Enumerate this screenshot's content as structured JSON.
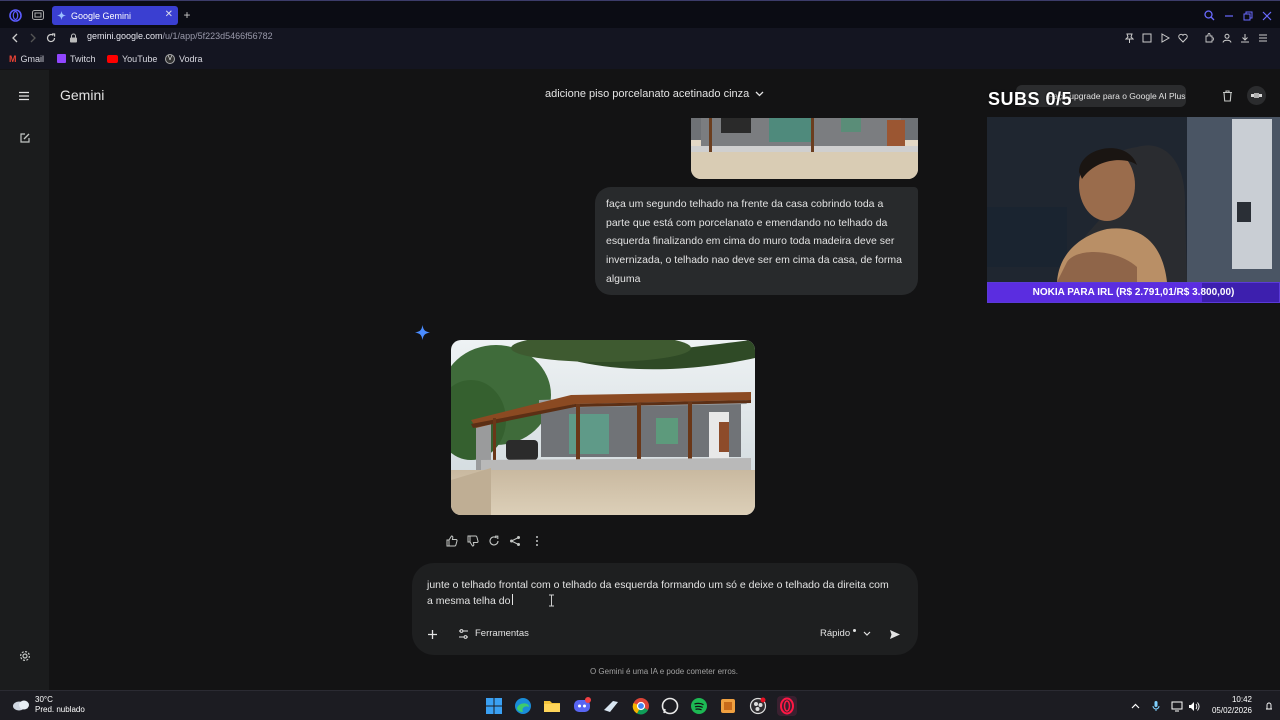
{
  "browser": {
    "tab_title": "Google Gemini",
    "url_domain": "gemini.google.com",
    "url_path": "/u/1/app/5f223d5466f56782",
    "bookmarks": [
      "Gmail",
      "Twitch",
      "YouTube",
      "Vodra"
    ]
  },
  "app": {
    "name": "Gemini",
    "conversation_title": "adicione piso porcelanato acetinado cinza",
    "upgrade_text": "Faça upgrade para o Google AI Plus"
  },
  "chat": {
    "user_message": "faça um segundo telhado na frente da casa cobrindo toda a parte que está com porcelanato e emendando no telhado da esquerda finalizando em cima do muro toda madeira deve ser invernizada, o telhado nao deve ser em cima da casa, de forma alguma",
    "input_text": "junte o telhado frontal com o telhado da esquerda formando um só e deixe o telhado da direita com a mesma telha do",
    "tools_label": "Ferramentas",
    "mode_label": "Rápido",
    "disclaimer": "O Gemini é uma IA e pode cometer erros."
  },
  "overlay": {
    "subs_label": "SUBS",
    "subs_count": "0/5",
    "goal_text": "NOKIA PARA IRL (R$ 2.791,01/R$ 3.800,00)",
    "goal_progress": 0.7345
  },
  "taskbar": {
    "temperature": "30°C",
    "weather_desc": "Pred. nublado",
    "time": "10:42",
    "date": "05/02/2026"
  },
  "colors": {
    "background": "#131314",
    "accent_tab": "#3a3fd1",
    "gemini_star": "#4a8cff",
    "goal_bar": "#3d1fae"
  }
}
